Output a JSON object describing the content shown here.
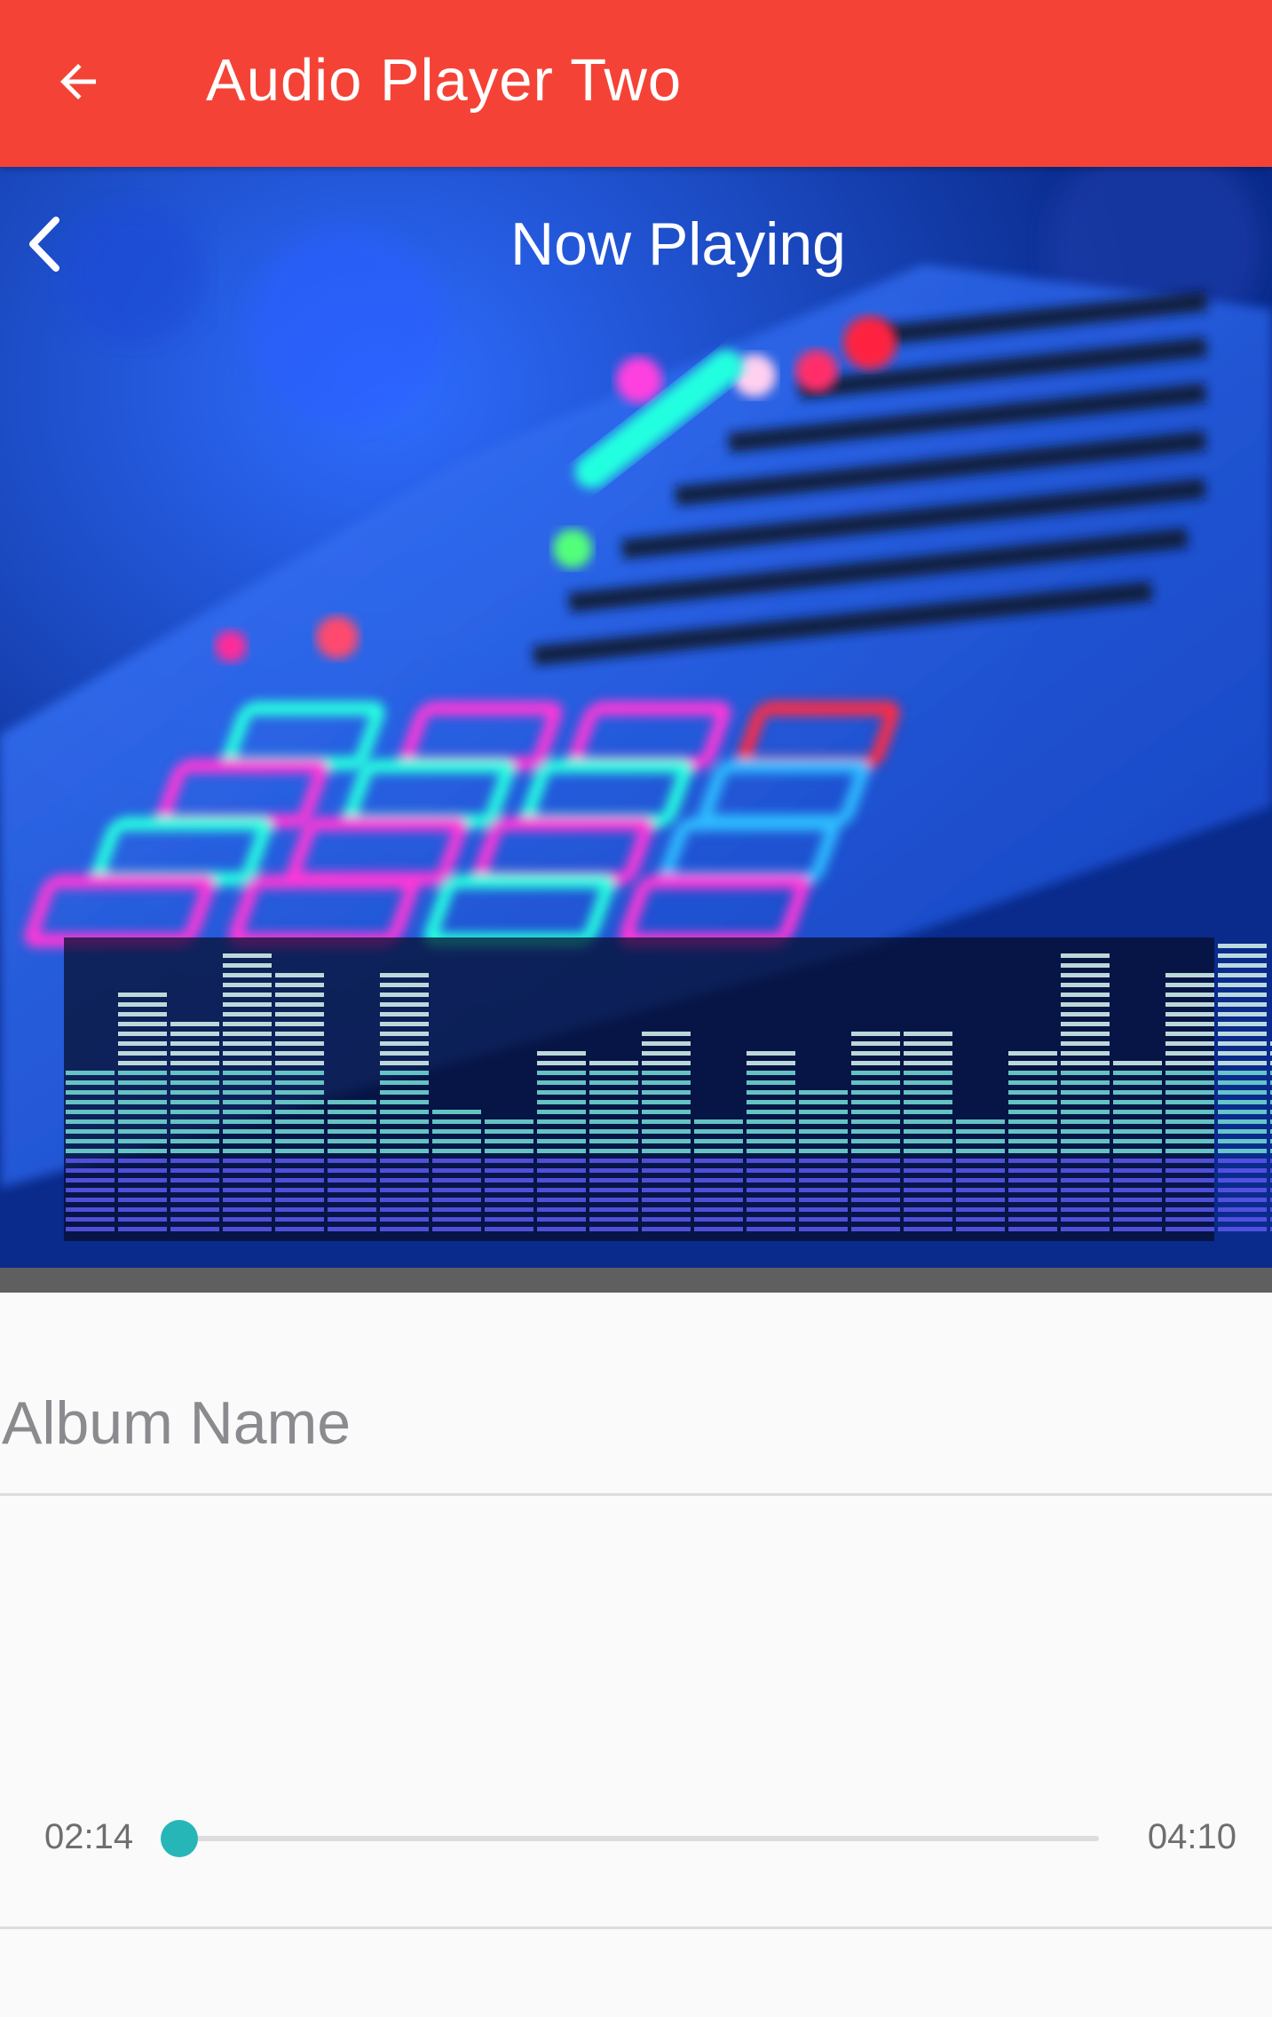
{
  "appbar": {
    "title": "Audio Player Two",
    "background_color": "#f44336",
    "back_icon": "arrow-left-icon"
  },
  "now_playing": {
    "title": "Now Playing",
    "back_icon": "chevron-left-icon",
    "artwork": "midi-controller-equalizer-artwork"
  },
  "album": {
    "name": "Album Name"
  },
  "player": {
    "current_time": "02:14",
    "total_time": "04:10",
    "progress": 0.0,
    "accent_color": "#26b6b8"
  }
}
